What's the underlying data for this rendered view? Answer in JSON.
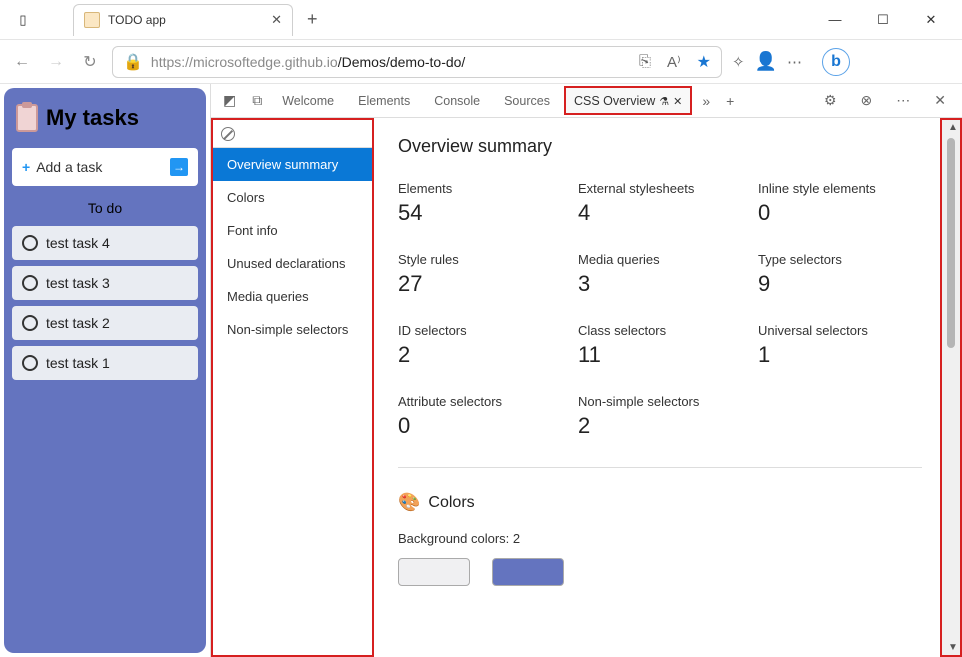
{
  "browser": {
    "tab_title": "TODO app",
    "url_prefix": "https://",
    "url_host": "microsoftedge.github.io",
    "url_path": "/Demos/demo-to-do/"
  },
  "app": {
    "title": "My tasks",
    "add_task_label": "Add a task",
    "section_header": "To do",
    "tasks": [
      {
        "label": "test task 4"
      },
      {
        "label": "test task 3"
      },
      {
        "label": "test task 2"
      },
      {
        "label": "test task 1"
      }
    ]
  },
  "devtools": {
    "tabs": {
      "welcome": "Welcome",
      "elements": "Elements",
      "console": "Console",
      "sources": "Sources",
      "css_overview": "CSS Overview"
    },
    "sidebar": [
      "Overview summary",
      "Colors",
      "Font info",
      "Unused declarations",
      "Media queries",
      "Non-simple selectors"
    ],
    "overview": {
      "heading": "Overview summary",
      "stats": [
        {
          "label": "Elements",
          "value": "54"
        },
        {
          "label": "External stylesheets",
          "value": "4"
        },
        {
          "label": "Inline style elements",
          "value": "0"
        },
        {
          "label": "Style rules",
          "value": "27"
        },
        {
          "label": "Media queries",
          "value": "3"
        },
        {
          "label": "Type selectors",
          "value": "9"
        },
        {
          "label": "ID selectors",
          "value": "2"
        },
        {
          "label": "Class selectors",
          "value": "11"
        },
        {
          "label": "Universal selectors",
          "value": "1"
        },
        {
          "label": "Attribute selectors",
          "value": "0"
        },
        {
          "label": "Non-simple selectors",
          "value": "2"
        }
      ],
      "colors_heading": "Colors",
      "colors_sub": "Background colors: 2",
      "swatches": [
        "#f0f0f2",
        "#6474bf"
      ]
    }
  }
}
